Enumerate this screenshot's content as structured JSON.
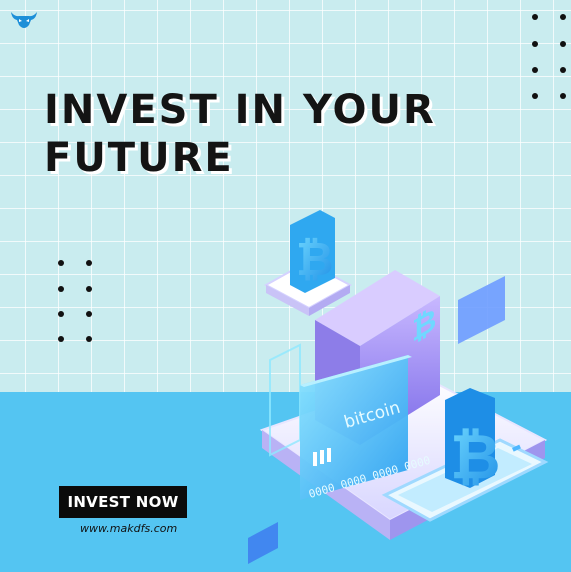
{
  "headline": {
    "line1": "INVEST IN YOUR",
    "line2": "FUTURE"
  },
  "cta": {
    "label": "INVEST NOW"
  },
  "website": "www.makdfs.com",
  "card": {
    "brand": "bitcoin",
    "number": "0000 0000 0000 0000"
  },
  "icons": {
    "logo": "bull-logo-icon",
    "currency": "bitcoin-icon"
  },
  "colors": {
    "background": "#c9ecef",
    "bottom_band": "#54c5f2",
    "headline": "#141414",
    "button": "#0b0b0b",
    "accent_purple": "#9b8cf0",
    "accent_blue": "#2fb7f5"
  }
}
